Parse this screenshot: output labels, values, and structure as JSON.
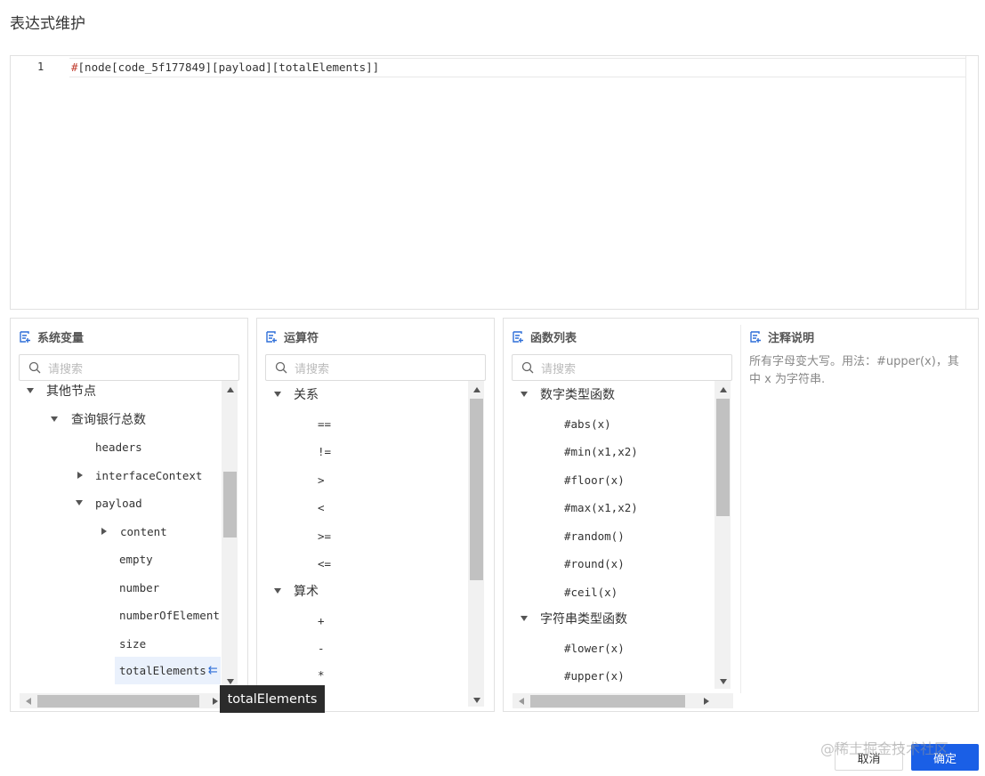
{
  "page_title": "表达式维护",
  "editor": {
    "line_number": "1",
    "code_hash": "#",
    "code_rest": "[node[code_5f177849][payload][totalElements]]"
  },
  "panels": {
    "variables": {
      "title": "系统变量",
      "search_placeholder": "请搜索",
      "items": {
        "other_nodes": "其他节点",
        "query_bank_total": "查询银行总数",
        "headers": "headers",
        "interface_context": "interfaceContext",
        "payload": "payload",
        "content": "content",
        "empty": "empty",
        "number": "number",
        "number_of_elements": "numberOfElements",
        "size": "size",
        "total_elements": "totalElements"
      }
    },
    "operators": {
      "title": "运算符",
      "search_placeholder": "请搜索",
      "group_relation": "关系",
      "relation_ops": [
        "==",
        "!=",
        ">",
        "<",
        ">=",
        "<="
      ],
      "group_arith": "算术",
      "arith_ops": [
        "+",
        "-",
        "*"
      ]
    },
    "functions": {
      "title": "函数列表",
      "search_placeholder": "请搜索",
      "group_number": "数字类型函数",
      "number_funcs": [
        "#abs(x)",
        "#min(x1,x2)",
        "#floor(x)",
        "#max(x1,x2)",
        "#random()",
        "#round(x)",
        "#ceil(x)"
      ],
      "group_string": "字符串类型函数",
      "string_funcs": [
        "#lower(x)",
        "#upper(x)"
      ]
    },
    "notes": {
      "title": "注释说明",
      "line1": "所有字母变大写。用法：#upper(x)，其",
      "line2": "中 x 为字符串."
    }
  },
  "tooltip": "totalElements",
  "buttons": {
    "cancel": "取消",
    "ok": "确定"
  },
  "watermark": "@稀土掘金技术社区",
  "colors": {
    "primary": "#1a5fe6",
    "selected_row_bg": "#eaf1fc",
    "tooltip_bg": "#2b2b2b"
  }
}
